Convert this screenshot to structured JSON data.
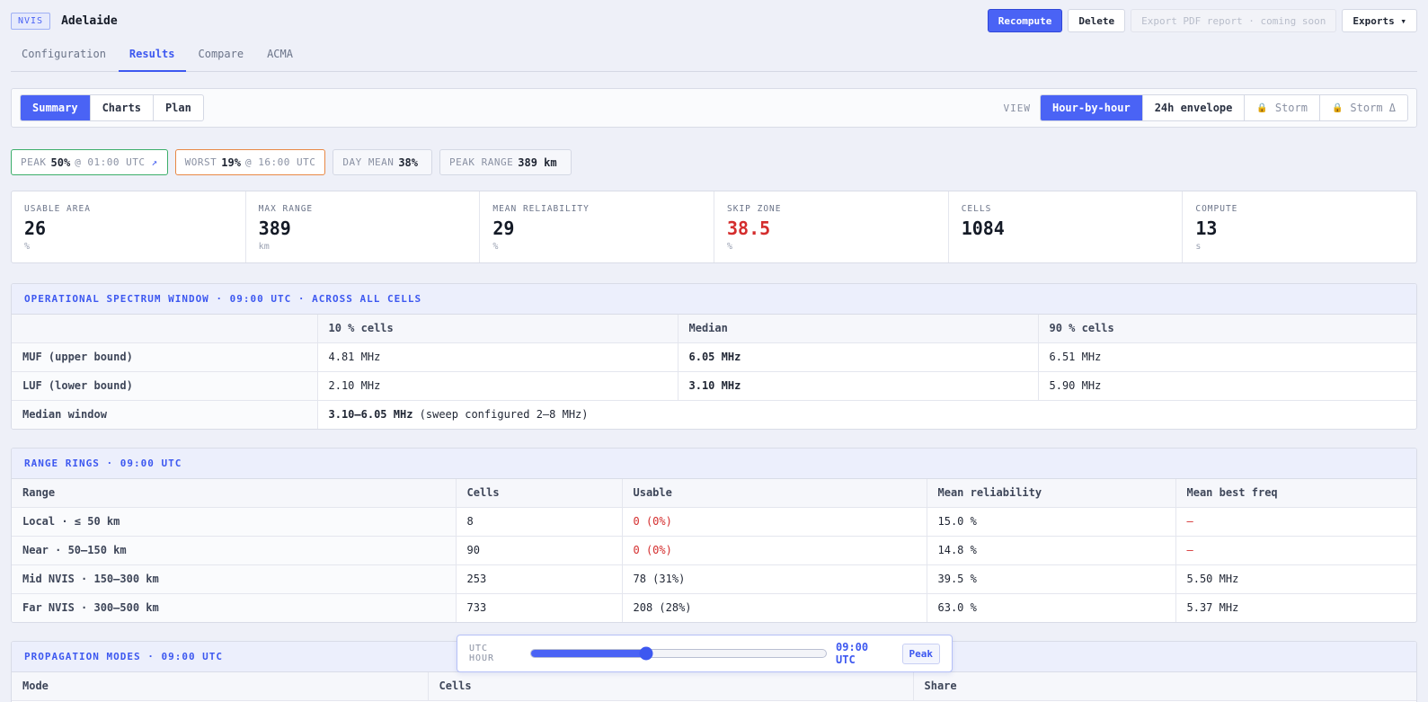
{
  "header": {
    "badge": "NVIS",
    "site": "Adelaide",
    "actions": {
      "recompute": "Recompute",
      "delete": "Delete",
      "export_pdf": "Export PDF report · coming soon",
      "exports": "Exports ▾"
    }
  },
  "tabs": [
    "Configuration",
    "Results",
    "Compare",
    "ACMA"
  ],
  "subtabs": [
    "Summary",
    "Charts",
    "Plan"
  ],
  "view": {
    "label": "VIEW",
    "options": [
      "Hour-by-hour",
      "24h envelope",
      "Storm",
      "Storm Δ"
    ]
  },
  "pills": {
    "peak": {
      "label": "PEAK",
      "value": "50%",
      "suffix": "@ 01:00 UTC",
      "arrow": "↗"
    },
    "worst": {
      "label": "WORST",
      "value": "19%",
      "suffix": "@ 16:00 UTC"
    },
    "day_mean": {
      "label": "DAY MEAN",
      "value": "38%"
    },
    "peak_range": {
      "label": "PEAK RANGE",
      "value": "389 km"
    }
  },
  "stats": [
    {
      "label": "USABLE AREA",
      "value": "26",
      "unit": "%"
    },
    {
      "label": "MAX RANGE",
      "value": "389",
      "unit": "km"
    },
    {
      "label": "MEAN RELIABILITY",
      "value": "29",
      "unit": "%"
    },
    {
      "label": "SKIP ZONE",
      "value": "38.5",
      "unit": "%"
    },
    {
      "label": "CELLS",
      "value": "1084",
      "unit": ""
    },
    {
      "label": "COMPUTE",
      "value": "13",
      "unit": "s"
    }
  ],
  "spectrum": {
    "title": "OPERATIONAL SPECTRUM WINDOW · 09:00 UTC · ACROSS ALL CELLS",
    "headers": [
      "",
      "10 % cells",
      "Median",
      "90 % cells"
    ],
    "rows": [
      {
        "label": "MUF (upper bound)",
        "p10": "4.81 MHz",
        "median": "6.05 MHz",
        "p90": "6.51 MHz"
      },
      {
        "label": "LUF (lower bound)",
        "p10": "2.10 MHz",
        "median": "3.10 MHz",
        "p90": "5.90 MHz"
      }
    ],
    "window": {
      "label": "Median window",
      "value": "3.10–6.05 MHz",
      "note": "(sweep configured 2–8 MHz)"
    }
  },
  "rings": {
    "title": "RANGE RINGS · 09:00 UTC",
    "headers": [
      "Range",
      "Cells",
      "Usable",
      "Mean reliability",
      "Mean best freq"
    ],
    "rows": [
      {
        "range": "Local · ≤ 50 km",
        "cells": "8",
        "usable": "0 (0%)",
        "reliability": "15.0 %",
        "freq": "—"
      },
      {
        "range": "Near · 50–150 km",
        "cells": "90",
        "usable": "0 (0%)",
        "reliability": "14.8 %",
        "freq": "—"
      },
      {
        "range": "Mid NVIS · 150–300 km",
        "cells": "253",
        "usable": "78 (31%)",
        "reliability": "39.5 %",
        "freq": "5.50 MHz"
      },
      {
        "range": "Far NVIS · 300–500 km",
        "cells": "733",
        "usable": "208 (28%)",
        "reliability": "63.0 %",
        "freq": "5.37 MHz"
      }
    ]
  },
  "modes": {
    "title": "PROPAGATION MODES · 09:00 UTC",
    "headers": [
      "Mode",
      "Cells",
      "Share"
    ]
  },
  "utc_slider": {
    "label": "UTC HOUR",
    "hour": 9,
    "max_hour": 23,
    "value": "09:00 UTC",
    "peak": "Peak"
  },
  "colors": {
    "accent": "#4a63f5",
    "danger": "#d42d2d",
    "peak_border": "#3cae6a",
    "worst_border": "#e88845"
  }
}
